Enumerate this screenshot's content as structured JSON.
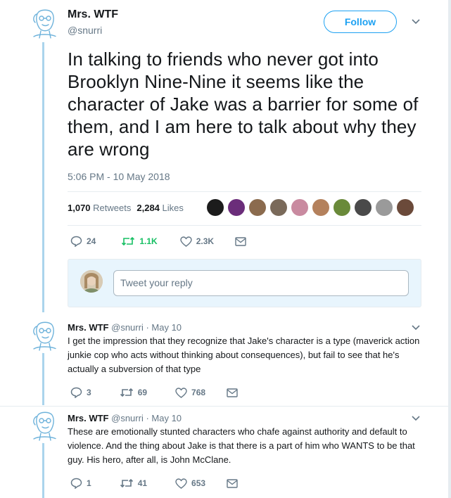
{
  "tweet": {
    "author_name": "Mrs. WTF",
    "author_handle": "@snurri",
    "follow_label": "Follow",
    "text": "In talking to friends who never got into Brooklyn Nine-Nine it seems like the character of Jake was a barrier for some of them, and I am here to talk about why they are wrong",
    "timestamp": "5:06 PM - 10 May 2018",
    "retweets_count": "1,070",
    "retweets_label": "Retweets",
    "likes_count": "2,284",
    "likes_label": "Likes",
    "liker_colors": [
      "#1c1c1c",
      "#6b2d7a",
      "#8b6b4e",
      "#7a6a5a",
      "#c98aa0",
      "#b4815c",
      "#6a8a3a",
      "#4a4a4a",
      "#9a9a9a",
      "#6b4a3a"
    ],
    "actions": {
      "replies": "24",
      "retweets": "1.1K",
      "likes": "2.3K"
    }
  },
  "reply_box": {
    "placeholder": "Tweet your reply"
  },
  "replies": [
    {
      "author_name": "Mrs. WTF",
      "author_handle": "@snurri",
      "date": "· May 10",
      "text": "I get the impression that they recognize that Jake's character is a type (maverick action junkie cop who acts without thinking about consequences), but fail to see that he's actually a subversion of that type",
      "actions": {
        "replies": "3",
        "retweets": "69",
        "likes": "768"
      }
    },
    {
      "author_name": "Mrs. WTF",
      "author_handle": "@snurri",
      "date": "· May 10",
      "text": "These are emotionally stunted characters who chafe against authority and default to violence. And the thing about Jake is that there is a part of him who WANTS to be that guy. His hero, after all, is John McClane.",
      "actions": {
        "replies": "1",
        "retweets": "41",
        "likes": "653"
      }
    }
  ],
  "colors": {
    "accent": "#1da1f2",
    "retweet_active": "#17bf63",
    "muted": "#657786",
    "thread_line": "#aad4ec"
  }
}
